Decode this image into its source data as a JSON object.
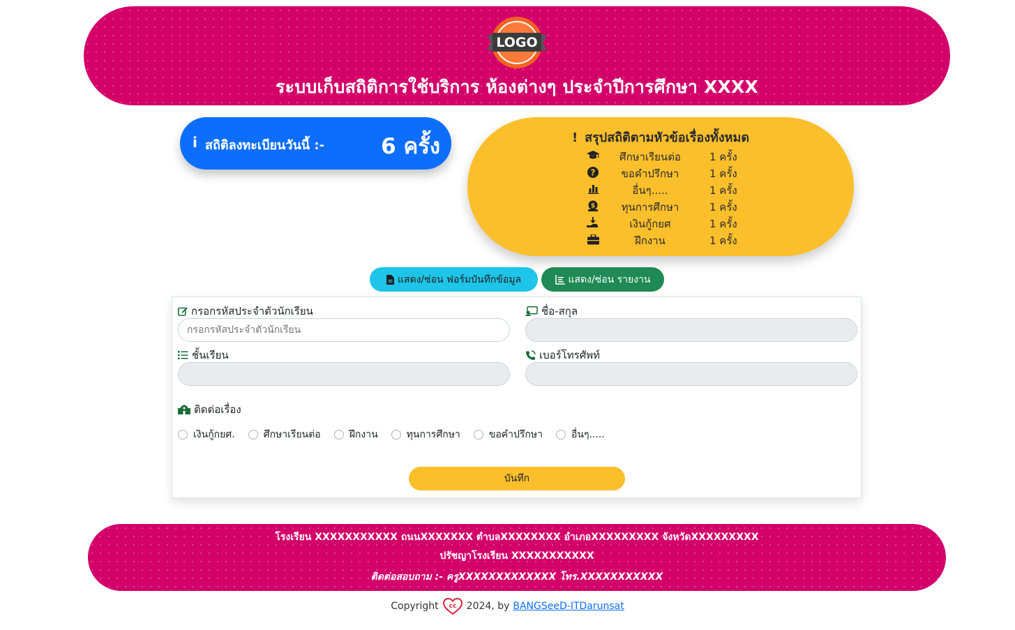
{
  "header": {
    "logo_text": "LOGO",
    "title": "ระบบเก็บสถิติการใช้บริการ ห้องต่างๆ ประจำปีการศึกษา XXXX"
  },
  "today": {
    "icon": "info-icon",
    "label": "สถิติลงทะเบียนวันนี้ :-",
    "count": "6 ครั้ง"
  },
  "summary": {
    "title": "สรุปสถิติตามหัวข้อเรื่องทั้งหมด",
    "items": [
      {
        "icon": "graduation-cap-icon",
        "label": "ศึกษาเรียนต่อ",
        "count": "1 ครั้ง"
      },
      {
        "icon": "question-circle-icon",
        "label": "ขอคำปรึกษา",
        "count": "1 ครั้ง"
      },
      {
        "icon": "bar-chart-icon",
        "label": "อื่นๆ.....",
        "count": "1 ครั้ง"
      },
      {
        "icon": "money-bag-icon",
        "label": "ทุนการศึกษา",
        "count": "1 ครั้ง"
      },
      {
        "icon": "hand-coin-icon",
        "label": "เงินกู้กยศ",
        "count": "1 ครั้ง"
      },
      {
        "icon": "briefcase-icon",
        "label": "ฝึกงาน",
        "count": "1 ครั้ง"
      }
    ]
  },
  "buttons": {
    "toggle_form": "แสดง/ซ่อน ฟอร์มบันทึกข้อมูล",
    "toggle_report": "แสดง/ซ่อน รายงาน"
  },
  "form": {
    "student_id_label": "กรอกรหัสประจำตัวนักเรียน",
    "student_id_placeholder": "กรอกรหัสประจำตัวนักเรียน",
    "student_id_value": "",
    "name_label": "ชื่อ-สกุล",
    "name_value": "",
    "class_label": "ชั้นเรียน",
    "class_value": "",
    "phone_label": "เบอร์โทรศัพท์",
    "phone_value": "",
    "topic_label": "ติดต่อเรื่อง",
    "topics": [
      "เงินกู้กยศ.",
      "ศึกษาเรียนต่อ",
      "ฝึกงาน",
      "ทุนการศึกษา",
      "ขอคำปรึกษา",
      "อื่นๆ....."
    ],
    "save_label": "บันทึก"
  },
  "footer": {
    "line1": "โรงเรียน XXXXXXXXXXX ถนนXXXXXXX ตำบลXXXXXXXX อำเภอXXXXXXXXX จังหวัดXXXXXXXXX",
    "line2": "ปรัชญาโรงเรียน XXXXXXXXXXX",
    "line3": "ติดต่อสอบถาม :- ครูXXXXXXXXXXXXX โทร.XXXXXXXXXXX"
  },
  "copyright": {
    "prefix": "Copyright",
    "year_by": "2024, by",
    "link_text": "BANGSeeD-ITDarunsat"
  },
  "colors": {
    "header_bg": "#d4006a",
    "today_bg": "#0d6efd",
    "summary_bg": "#fbbf2c",
    "btn_form_bg": "#1fc5e8",
    "btn_report_bg": "#1f8a55",
    "save_bg": "#fbbf2c"
  }
}
